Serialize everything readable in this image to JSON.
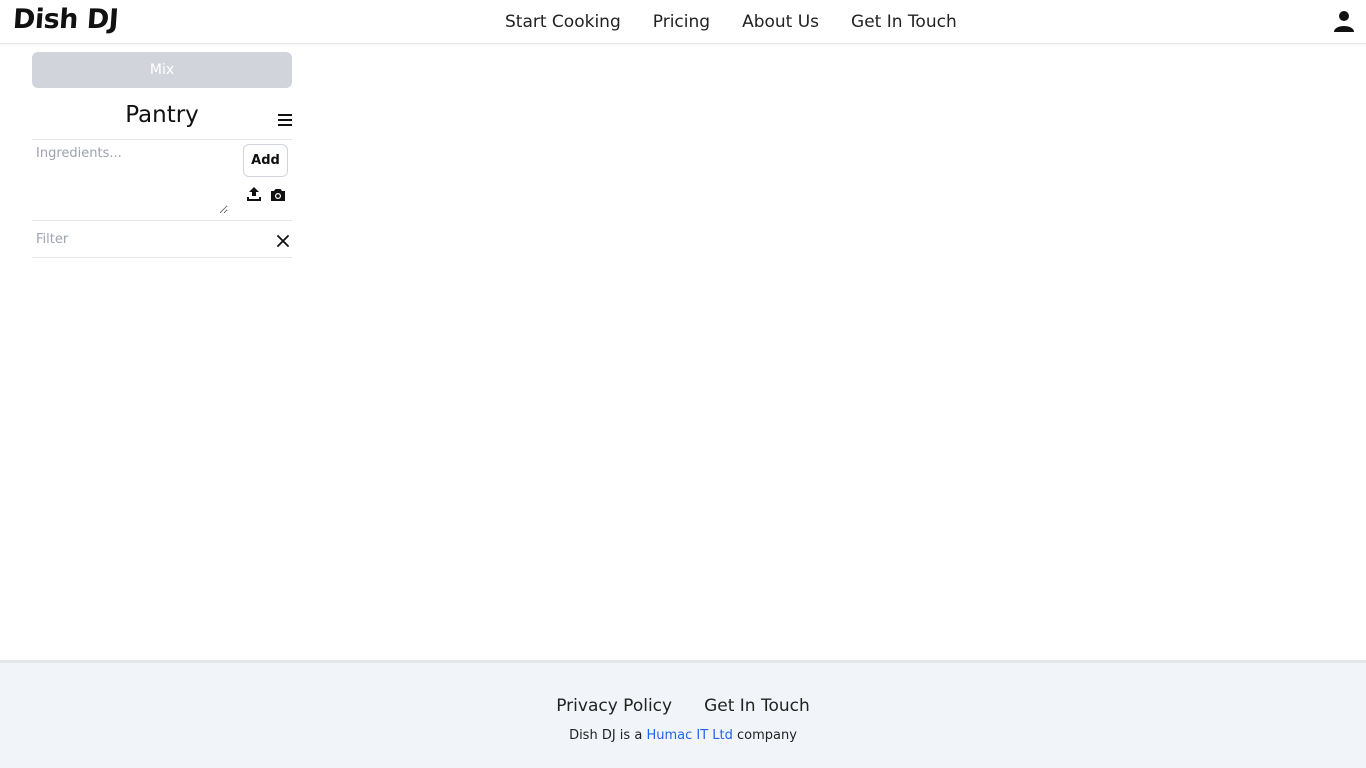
{
  "header": {
    "logo": "Dish DJ",
    "nav": [
      "Start Cooking",
      "Pricing",
      "About Us",
      "Get In Touch"
    ],
    "user_icon": "user-icon"
  },
  "sidebar": {
    "mix_label": "Mix",
    "mix_color": "#d1d5db",
    "pantry_title": "Pantry",
    "menu_icon": "hamburger-menu-icon",
    "ingredients_placeholder": "Ingredients...",
    "add_label": "Add",
    "upload_icon": "upload-icon",
    "camera_icon": "camera-icon",
    "filter_placeholder": "Filter",
    "clear_icon": "close-icon"
  },
  "footer": {
    "links": [
      "Privacy Policy",
      "Get In Touch"
    ],
    "note_prefix": "Dish DJ is a",
    "note_link": "Humac IT Ltd",
    "note_suffix": "company",
    "link_color": "#2563eb",
    "background": "#f1f4f8"
  }
}
